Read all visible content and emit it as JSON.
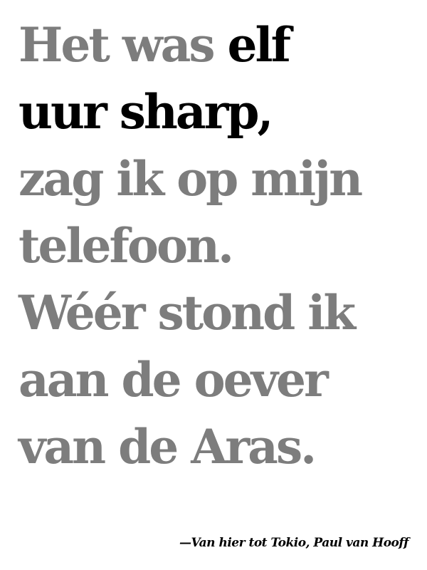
{
  "quote": {
    "line1_plain": "Het was ",
    "line1_emph": "elf",
    "line2_emph": "uur sharp,",
    "line3": "zag ik op mijn",
    "line4": "telefoon.",
    "line5": "Wéér stond ik",
    "line6": "aan de oever",
    "line7": "van de Aras."
  },
  "attribution": "—Van hier tot Tokio, Paul van Hooff",
  "colors": {
    "background": "#ffffff",
    "muted_text": "#7d7d7d",
    "emphasis_text": "#000000"
  }
}
